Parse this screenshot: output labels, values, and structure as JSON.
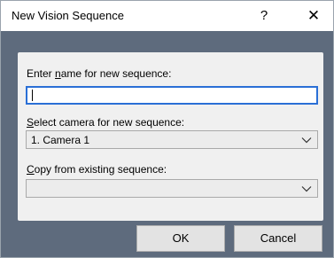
{
  "window": {
    "title": "New Vision Sequence",
    "help_glyph": "?",
    "close_glyph": "✕"
  },
  "form": {
    "name_label_pre": "Enter ",
    "name_label_mnemonic": "n",
    "name_label_post": "ame for new sequence:",
    "name_value": "",
    "camera_label_mnemonic": "S",
    "camera_label_post": "elect camera for new sequence:",
    "camera_selected": "1. Camera 1",
    "copy_label_mnemonic": "C",
    "copy_label_post": "opy from existing sequence:",
    "copy_selected": ""
  },
  "buttons": {
    "ok_label": "OK",
    "cancel_label": "Cancel"
  },
  "colors": {
    "dialog_body": "#5e6b7d",
    "panel": "#f0f0f0",
    "focus_border": "#2a6fd6"
  },
  "icons": {
    "help": "help-icon",
    "close": "close-icon",
    "dropdown": "chevron-down-icon"
  }
}
